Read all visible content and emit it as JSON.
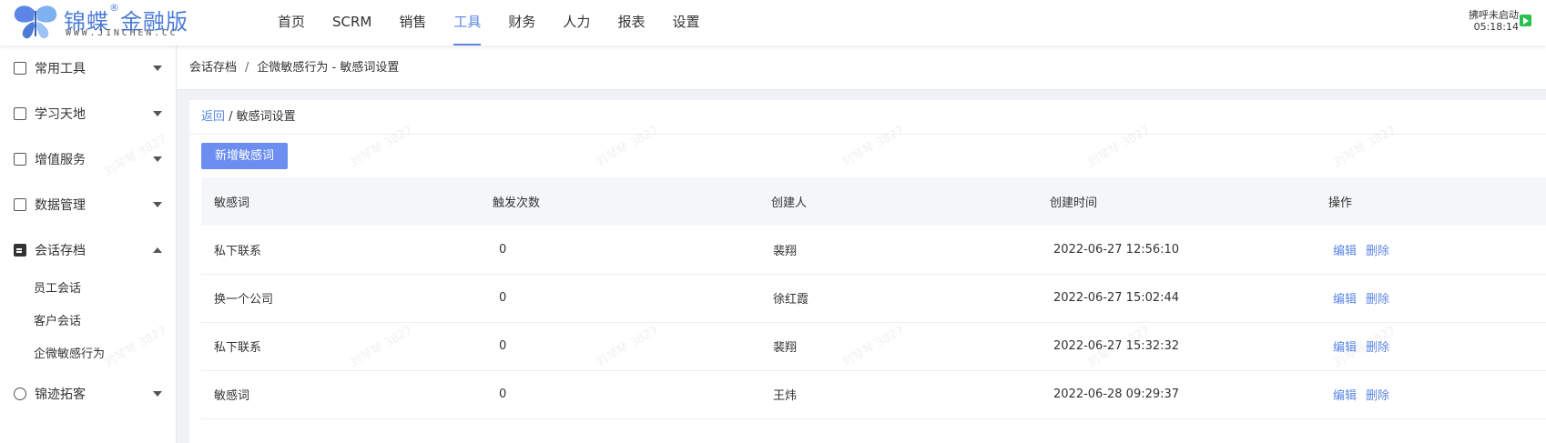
{
  "header": {
    "logo_text": "锦蝶",
    "logo_reg": "®",
    "logo_suffix": "金融版",
    "logo_sub": "WWW.JINCHEN.CC",
    "nav": [
      "首页",
      "SCRM",
      "销售",
      "工具",
      "财务",
      "人力",
      "报表",
      "设置"
    ],
    "active_nav": "工具",
    "status_label": "拂呼未启动",
    "status_time": "05:18:14"
  },
  "sidebar": {
    "items": [
      {
        "label": "常用工具",
        "icon": "clipboard-icon",
        "expanded": false
      },
      {
        "label": "学习天地",
        "icon": "book-icon",
        "expanded": false
      },
      {
        "label": "增值服务",
        "icon": "home-icon",
        "expanded": false
      },
      {
        "label": "数据管理",
        "icon": "grid-icon",
        "expanded": false
      },
      {
        "label": "会话存档",
        "icon": "id-card-icon",
        "expanded": true,
        "children": [
          "员工会话",
          "客户会话",
          "企微敏感行为"
        ]
      },
      {
        "label": "锦迹拓客",
        "icon": "footprint-icon",
        "expanded": false
      }
    ]
  },
  "breadcrumb": {
    "parent": "会话存档",
    "sep": "/",
    "current": "企微敏感行为 - 敏感词设置"
  },
  "panel": {
    "back": "返回",
    "sep": " / ",
    "title": "敏感词设置",
    "add_button": "新增敏感词"
  },
  "table": {
    "headers": [
      "敏感词",
      "触发次数",
      "创建人",
      "创建时间",
      "操作"
    ],
    "rows": [
      {
        "word": "私下联系",
        "count": "0",
        "creator": "裴翔",
        "time": "2022-06-27 12:56:10"
      },
      {
        "word": "换一个公司",
        "count": "0",
        "creator": "徐红霞",
        "time": "2022-06-27 15:02:44"
      },
      {
        "word": "私下联系",
        "count": "0",
        "creator": "裴翔",
        "time": "2022-06-27 15:32:32"
      },
      {
        "word": "敏感词",
        "count": "0",
        "creator": "王炜",
        "time": "2022-06-28 09:29:37"
      }
    ],
    "edit": "编辑",
    "delete": "删除"
  },
  "watermark": "刘琴琴 3827",
  "colors": {
    "accent": "#5b86e5",
    "button": "#6b8ef0",
    "status": "#27c24c"
  }
}
